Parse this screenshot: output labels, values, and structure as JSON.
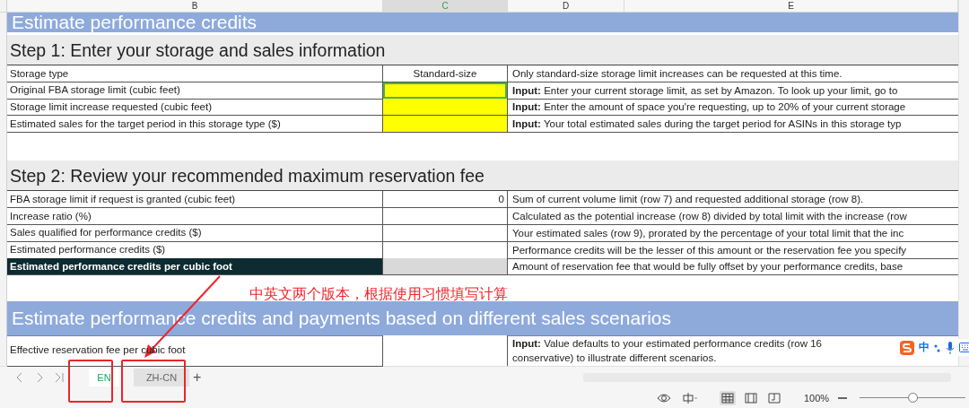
{
  "columns": [
    {
      "label": "B",
      "selected": false
    },
    {
      "label": "C",
      "selected": true
    },
    {
      "label": "D",
      "selected": false
    },
    {
      "label": "E",
      "selected": false
    }
  ],
  "rows": [
    {
      "kind": "banner",
      "title": "Estimate performance credits"
    },
    {
      "kind": "heading",
      "title": "Step 1: Enter your storage and sales information"
    },
    {
      "kind": "data",
      "label": "Storage type",
      "cell": {
        "kind": "text",
        "text": "Standard-size",
        "selected": false
      },
      "note": "Only standard-size storage limit increases can be requested at this time.",
      "highlighted": false
    },
    {
      "kind": "data",
      "label": "Original FBA storage limit (cubic feet)",
      "cell": {
        "kind": "input",
        "selected": true
      },
      "note": "**Input:** Enter your current storage limit, as set by Amazon. To look up your limit, go to",
      "highlighted": false
    },
    {
      "kind": "data",
      "label": "Storage limit increase requested (cubic feet)",
      "cell": {
        "kind": "input",
        "selected": false
      },
      "note": "**Input:** Enter the amount of space you're requesting, up to 20% of your current storage",
      "highlighted": false
    },
    {
      "kind": "data",
      "label": "Estimated sales for the target period in this storage type ($)",
      "cell": {
        "kind": "input",
        "selected": false
      },
      "note": "**Input:** Your total estimated sales during the target period for ASINs in this storage typ",
      "highlighted": false
    },
    {
      "kind": "blank"
    },
    {
      "kind": "heading",
      "title": "Step 2: Review your recommended maximum reservation fee"
    },
    {
      "kind": "data",
      "label": "FBA storage limit if request is granted (cubic feet)",
      "cell": {
        "kind": "number",
        "text": "0",
        "selected": false
      },
      "note": "Sum of current volume limit (row 7) and requested additional storage (row 8).",
      "highlighted": false
    },
    {
      "kind": "data",
      "label": "Increase ratio (%)",
      "cell": {
        "kind": "empty",
        "selected": false
      },
      "note": "Calculated as the potential increase (row 8) divided by total limit with the increase (row",
      "highlighted": false
    },
    {
      "kind": "data",
      "label": "Sales qualified for performance credits ($)",
      "cell": {
        "kind": "empty",
        "selected": false
      },
      "note": "Your estimated sales (row 9), prorated by the percentage of your total limit that the inc",
      "highlighted": false
    },
    {
      "kind": "data",
      "label": "Estimated performance credits ($)",
      "cell": {
        "kind": "empty",
        "selected": false
      },
      "note": "Performance credits will be the lesser of this amount or the reservation fee you specify",
      "highlighted": false
    },
    {
      "kind": "data",
      "label": "Estimated performance credits per cubic foot",
      "cell": {
        "kind": "empty",
        "selected": false
      },
      "note": "Amount of reservation fee that would be fully offset by your performance credits, base",
      "highlighted": true
    },
    {
      "kind": "blank"
    },
    {
      "kind": "banner",
      "title": "Estimate performance credits and payments based on different sales scenarios"
    },
    {
      "kind": "data",
      "label": "Effective reservation fee per cubic foot",
      "cell": {
        "kind": "empty",
        "selected": false
      },
      "note": "**Input:** Value defaults to your estimated performance credits (row 16\nconservative) to illustrate different scenarios.",
      "highlighted": false
    }
  ],
  "sheet_tabs": [
    {
      "label": "EN",
      "selected": true
    },
    {
      "label": "ZH-CN",
      "selected": false
    }
  ],
  "add_sheet": "+",
  "zoom": {
    "label": "100%",
    "level": 0.5
  },
  "annotation": {
    "text": "中英文两个版本，根据使用习惯填写计算"
  },
  "ime_toolbar": {
    "mode": "中"
  }
}
